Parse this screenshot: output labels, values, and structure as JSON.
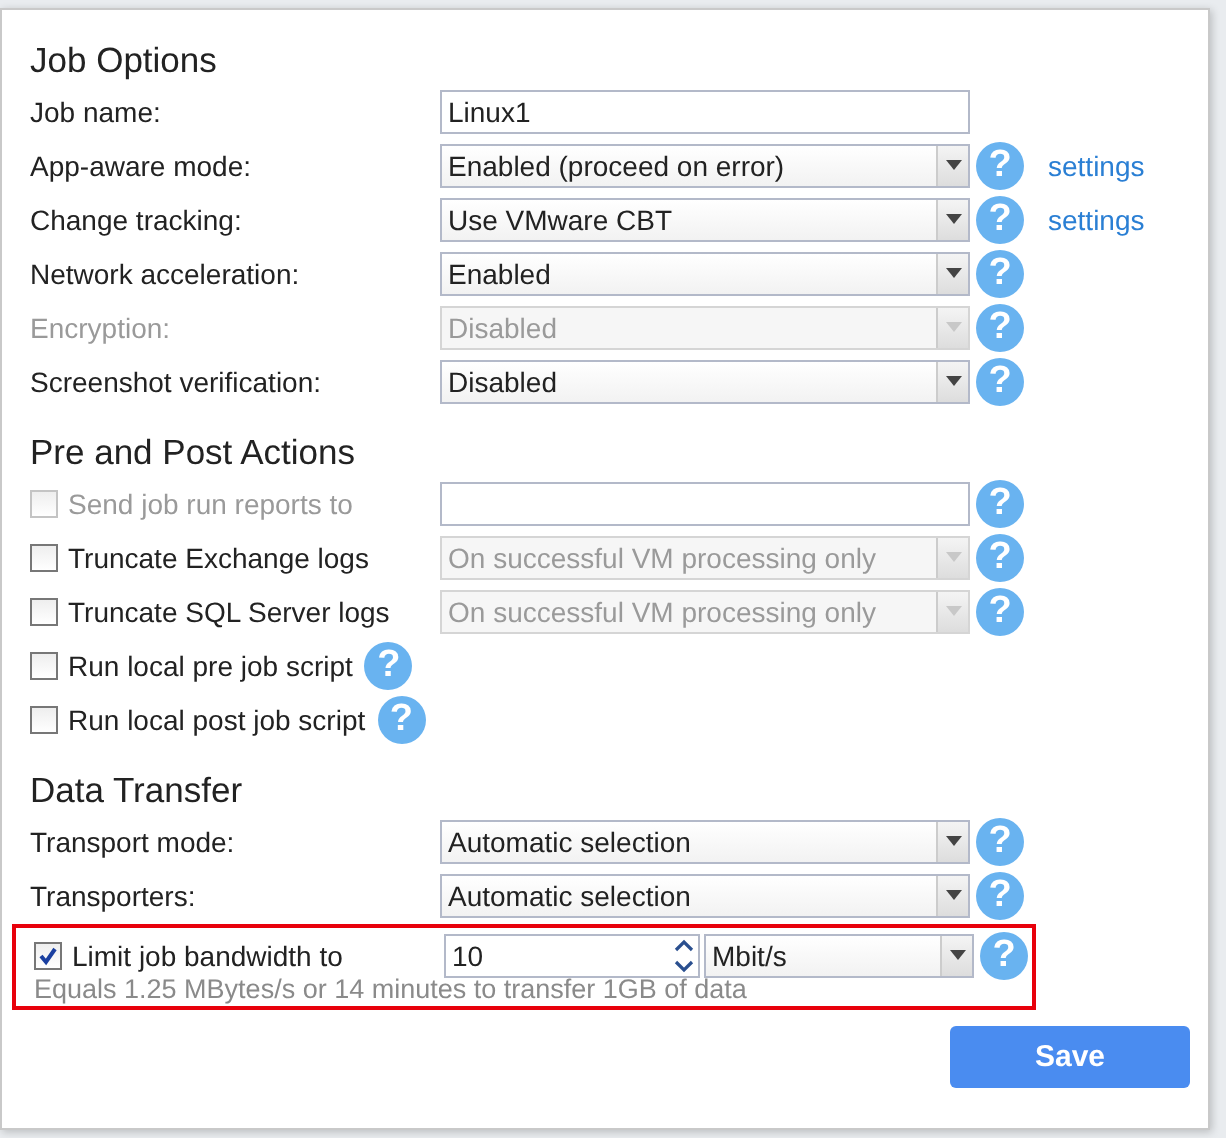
{
  "sections": [
    {
      "title": "Job Options",
      "rows": [
        {
          "kind": "field",
          "label": "Job name:",
          "disabled": false,
          "control": {
            "kind": "text",
            "value": "Linux1"
          }
        },
        {
          "kind": "field",
          "label": "App-aware mode:",
          "disabled": false,
          "control": {
            "kind": "select",
            "value": "Enabled (proceed on error)",
            "disabled": false
          },
          "help": "?",
          "link": "settings"
        },
        {
          "kind": "field",
          "label": "Change tracking:",
          "disabled": false,
          "control": {
            "kind": "select",
            "value": "Use VMware CBT",
            "disabled": false
          },
          "help": "?",
          "link": "settings"
        },
        {
          "kind": "field",
          "label": "Network acceleration:",
          "disabled": false,
          "control": {
            "kind": "select",
            "value": "Enabled",
            "disabled": false
          },
          "help": "?"
        },
        {
          "kind": "field",
          "label": "Encryption:",
          "disabled": true,
          "control": {
            "kind": "select",
            "value": "Disabled",
            "disabled": true
          },
          "help": "?"
        },
        {
          "kind": "field",
          "label": "Screenshot verification:",
          "disabled": false,
          "control": {
            "kind": "select",
            "value": "Disabled",
            "disabled": false
          },
          "help": "?"
        }
      ]
    },
    {
      "title": "Pre and Post Actions",
      "rows": [
        {
          "kind": "check",
          "label": "Send job run reports to",
          "checked": false,
          "disabled": true,
          "control": {
            "kind": "text"
          },
          "help": "?"
        },
        {
          "kind": "check",
          "label": "Truncate Exchange logs",
          "checked": false,
          "disabled": false,
          "control": {
            "kind": "select",
            "value": "On successful VM processing only",
            "disabled": true
          },
          "help": "?"
        },
        {
          "kind": "check",
          "label": "Truncate SQL Server logs",
          "checked": false,
          "disabled": false,
          "control": {
            "kind": "select",
            "value": "On successful VM processing only",
            "disabled": true
          },
          "help": "?"
        },
        {
          "kind": "check",
          "label": "Run local pre job script",
          "checked": false,
          "disabled": false,
          "help": "?"
        },
        {
          "kind": "check",
          "label": "Run local post job script",
          "checked": false,
          "disabled": false,
          "help": "?"
        }
      ]
    },
    {
      "title": "Data Transfer",
      "rows": [
        {
          "kind": "field",
          "label": "Transport mode:",
          "disabled": false,
          "control": {
            "kind": "select",
            "value": "Automatic selection",
            "disabled": false
          },
          "help": "?"
        },
        {
          "kind": "field",
          "label": "Transporters:",
          "disabled": false,
          "control": {
            "kind": "select",
            "value": "Automatic selection",
            "disabled": false
          },
          "help": "?"
        },
        {
          "kind": "bandwidth",
          "label": "Limit job bandwidth to",
          "checked": true,
          "value": "10",
          "unit": "Mbit/s",
          "help": "?",
          "note": "Equals 1.25 MBytes/s or 14 minutes to transfer 1GB of data",
          "highlighted": true
        }
      ]
    }
  ],
  "save_button": "Save"
}
